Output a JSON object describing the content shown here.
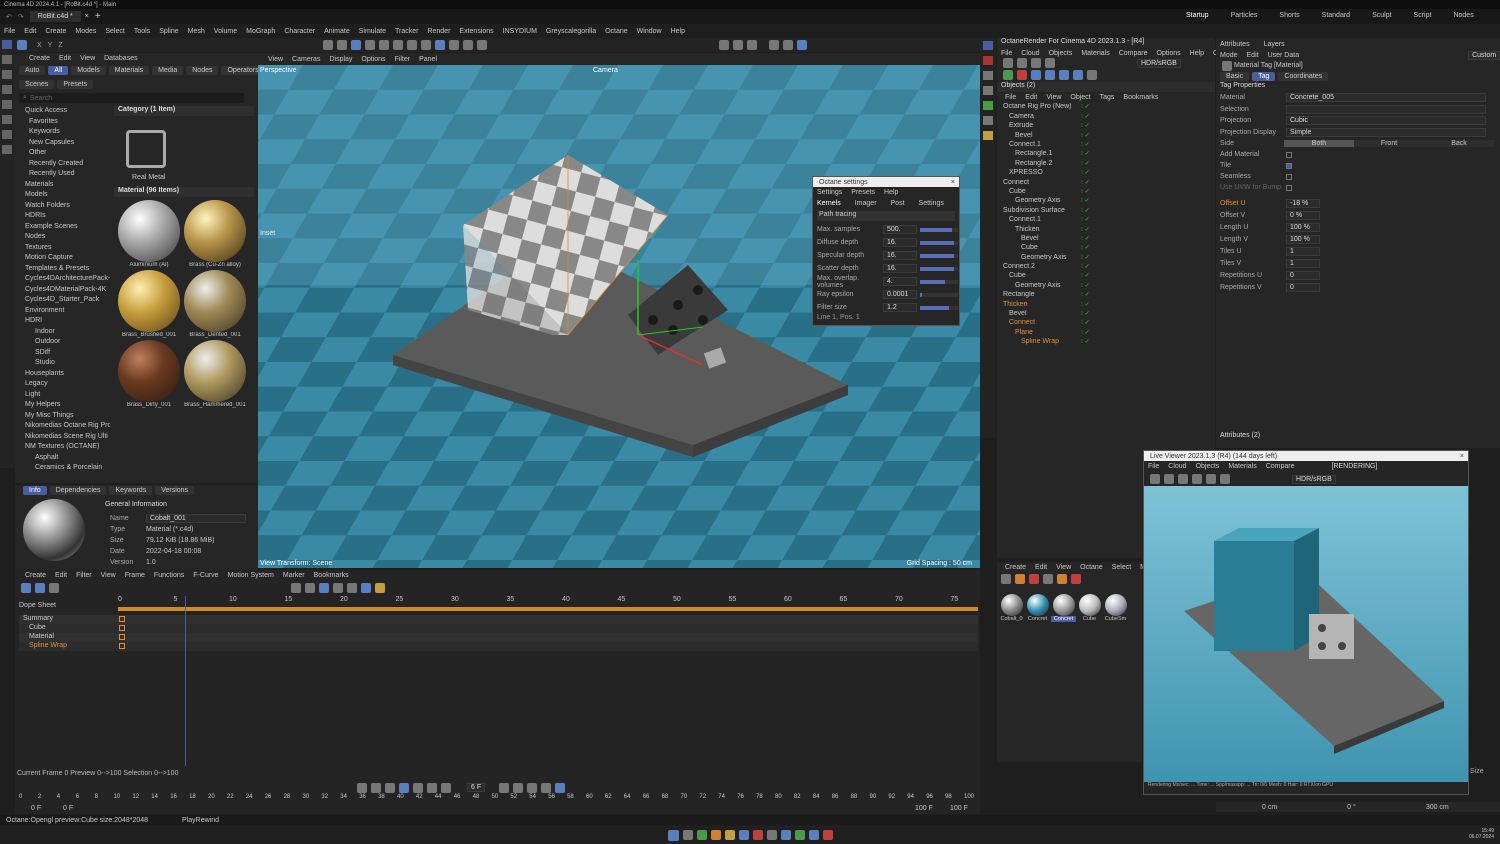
{
  "title_bar": {
    "text": "Cinema 4D 2024.4.1 - [RoBit.c4d *] - Main"
  },
  "doc_tab": {
    "label": "RoBit.c4d *"
  },
  "top_menu": [
    "File",
    "Edit",
    "Create",
    "Modes",
    "Select",
    "Tools",
    "Spline",
    "Mesh",
    "Volume",
    "MoGraph",
    "Character",
    "Animate",
    "Simulate",
    "Tracker",
    "Render",
    "Extensions",
    "INSYDIUM",
    "Greyscalegorilla",
    "Octane",
    "Window",
    "Help"
  ],
  "layouts": [
    "Startup",
    "Particles",
    "Shorts",
    "Standard",
    "Sculpt",
    "Script",
    "Nodes"
  ],
  "active_layout": "Startup",
  "asset_browser": {
    "menu": [
      "Create",
      "Edit",
      "View",
      "Databases"
    ],
    "tabs": [
      "Auto",
      "All",
      "Models",
      "Materials",
      "Media",
      "Nodes",
      "Operators"
    ],
    "tabs2": [
      "Scenes",
      "Presets"
    ],
    "search_placeholder": "Search",
    "tree": [
      "Quick Access",
      "Favorites",
      "Keywords",
      "New Capsules",
      "Other",
      "Recently Created",
      "Recently Used",
      "Materials",
      "Models",
      "Watch Folders",
      "HDRIs",
      "Example Scenes",
      "Nodes",
      "Textures",
      "Motion Capture",
      "Templates & Presets",
      "Cycles4DArchitecturePack-",
      "Cycles4DMaterialPack-4K",
      "Cycles4D_Starter_Pack",
      "Environment",
      "HDRI",
      "Indoor",
      "Outdoor",
      "SDiff",
      "Studio",
      "Houseplants",
      "Legacy",
      "Light",
      "My Helpers",
      "My Misc Things",
      "Nikomedias Octane Rig Pro",
      "Nikomedias Scene Rig Ulti",
      "NM Textures (OCTANE)",
      "Asphalt",
      "Ceramics & Porcelain"
    ],
    "category_header": "Category (1 Item)",
    "category_item": "Real Metal",
    "material_header": "Material (96 Items)",
    "materials": [
      "Aluminium (Al)",
      "Brass (Cu-Zn alloy)",
      "Brass_Brushed_001",
      "Brass_Dented_001",
      "Brass_Dirty_001",
      "Brass_Hammered_001"
    ],
    "info_tabs": [
      "Info",
      "Dependencies",
      "Keywords",
      "Versions"
    ],
    "info_section": "General Information",
    "info_fields": [
      {
        "k": "Name",
        "v": "Cobalt_001"
      },
      {
        "k": "Type",
        "v": "Material (*.c4d)"
      },
      {
        "k": "Size",
        "v": "79.12 KiB (18.86 MiB)"
      },
      {
        "k": "Date",
        "v": "2022-04-18 00:08"
      },
      {
        "k": "Version",
        "v": "1.0"
      }
    ]
  },
  "viewport": {
    "menu": [
      "View",
      "Cameras",
      "Display",
      "Options",
      "Filter",
      "Panel"
    ],
    "label": "Perspective",
    "camera": "Camera",
    "inset": "Inset",
    "bottom_left": "View Transform: Scene",
    "bottom_right": "Grid Spacing : 50 cm"
  },
  "octane_dialog": {
    "title": "Octane settings",
    "menu": [
      "Settings",
      "Presets",
      "Help"
    ],
    "tabs": [
      "Kernels",
      "Imager",
      "Post",
      "Settings"
    ],
    "kernel": "Path tracing",
    "params": [
      {
        "k": "Max. samples",
        "v": "500.",
        "f": 0.85
      },
      {
        "k": "Diffuse depth",
        "v": "16.",
        "f": 0.9
      },
      {
        "k": "Specular depth",
        "v": "16.",
        "f": 0.9
      },
      {
        "k": "Scatter depth",
        "v": "16.",
        "f": 0.9
      },
      {
        "k": "Max. overlap. volumes",
        "v": "4.",
        "f": 0.65
      },
      {
        "k": "Ray epsilon",
        "v": "0.0001",
        "f": 0.05
      },
      {
        "k": "Filter size",
        "v": "1.2",
        "f": 0.75
      }
    ],
    "status": "Line 1, Pos. 1"
  },
  "octane_panel": {
    "title": "OctaneRender For Cinema 4D 2023.1.3 - [R4]",
    "menu": [
      "File",
      "Cloud",
      "Objects",
      "Materials",
      "Compare",
      "Options",
      "Help",
      "GUI"
    ],
    "color": "HDR/sRGB"
  },
  "objects": {
    "header": "Objects (2)",
    "menu": [
      "File",
      "Edit",
      "View",
      "Object",
      "Tags",
      "Bookmarks"
    ],
    "items": [
      {
        "n": "Octane Rig Pro (New)",
        "d": 0
      },
      {
        "n": "Camera",
        "d": 1
      },
      {
        "n": "Extrude",
        "d": 1
      },
      {
        "n": "Bevel",
        "d": 2
      },
      {
        "n": "Connect.1",
        "d": 1
      },
      {
        "n": "Rectangle.1",
        "d": 2
      },
      {
        "n": "Rectangle.2",
        "d": 2
      },
      {
        "n": "XPRESSO",
        "d": 1
      },
      {
        "n": "Connect",
        "d": 0
      },
      {
        "n": "Cube",
        "d": 1
      },
      {
        "n": "Geometry Axis",
        "d": 2
      },
      {
        "n": "Subdivision Surface",
        "d": 0
      },
      {
        "n": "Connect.1",
        "d": 1
      },
      {
        "n": "Thicken",
        "d": 2
      },
      {
        "n": "Bevel",
        "d": 3
      },
      {
        "n": "Cube",
        "d": 3
      },
      {
        "n": "Geometry Axis",
        "d": 3
      },
      {
        "n": "Connect.2",
        "d": 0
      },
      {
        "n": "Cube",
        "d": 1
      },
      {
        "n": "Geometry Axis",
        "d": 2
      },
      {
        "n": "Rectangle",
        "d": 0
      },
      {
        "n": "Thicken",
        "d": 0,
        "o": 1
      },
      {
        "n": "Bevel",
        "d": 1
      },
      {
        "n": "Connect",
        "d": 1,
        "o": 1
      },
      {
        "n": "Plane",
        "d": 2,
        "o": 1
      },
      {
        "n": "Spline Wrap",
        "d": 3,
        "o": 1
      }
    ]
  },
  "attributes": {
    "tabs": [
      "Attributes",
      "Layers"
    ],
    "menu": [
      "Mode",
      "Edit",
      "User Data"
    ],
    "custom": "Custom",
    "title": "Material Tag [Material]",
    "sub_tabs": [
      "Basic",
      "Tag",
      "Coordinates"
    ],
    "section": "Tag Properties",
    "props": [
      {
        "k": "Material",
        "v": "Concrete_005"
      },
      {
        "k": "Selection",
        "v": ""
      },
      {
        "k": "Projection",
        "v": "Cubic"
      },
      {
        "k": "Projection Display",
        "v": "Simple"
      }
    ],
    "side_label": "Side",
    "side_opts": [
      "Both",
      "Front",
      "Back"
    ],
    "checks": [
      "Add Material",
      "Tile",
      "Seamless",
      "Use UVW for Bump"
    ],
    "nums": [
      {
        "k": "Offset U",
        "v": "-18 %",
        "o": 1
      },
      {
        "k": "Offset V",
        "v": "0 %"
      },
      {
        "k": "Length U",
        "v": "100 %"
      },
      {
        "k": "Length V",
        "v": "100 %"
      },
      {
        "k": "Tiles U",
        "v": "1"
      },
      {
        "k": "Tiles V",
        "v": "1"
      },
      {
        "k": "Repetitions U",
        "v": "0"
      },
      {
        "k": "Repetitions V",
        "v": "0"
      }
    ],
    "header2": "Attributes (2)"
  },
  "material_manager": {
    "menu": [
      "Create",
      "Edit",
      "View",
      "Octane",
      "Select",
      "Material"
    ],
    "mats": [
      "Cobalt_0",
      "Concret",
      "Concret",
      "Cube",
      "CubeSm"
    ]
  },
  "live_viewer": {
    "title": "Live Viewer 2023.1.3 (R4) (144 days left)",
    "menu": [
      "File",
      "Cloud",
      "Objects",
      "Materials",
      "Compare"
    ],
    "status": "[RENDERING]",
    "color": "HDR/sRGB",
    "footer": "Rendering    Ms/sec: ...    Time: ...    Spp/maxspp: ...    Tri: 0/0    Mesh: 0    Hair: 0    RTX/on    GPU"
  },
  "timeline": {
    "menu": [
      "Create",
      "Edit",
      "Filter",
      "View",
      "Frame",
      "Functions",
      "F-Curve",
      "Motion System",
      "Marker",
      "Bookmarks"
    ],
    "dope": "Dope Sheet",
    "tracks": [
      "Summary",
      "Cube",
      "Material",
      "Spline Wrap"
    ],
    "ruler": [
      "0",
      "5",
      "10",
      "15",
      "20",
      "25",
      "30",
      "35",
      "40",
      "45",
      "50",
      "55",
      "60",
      "65",
      "70",
      "75"
    ],
    "status": "Current Frame  0   Preview  0-->100     Selection  0-->100"
  },
  "transport": {
    "frame": "6 F",
    "start": "0 F",
    "start2": "0 F",
    "end": "100 F",
    "end2": "100 F",
    "ticks": [
      "0",
      "2",
      "4",
      "6",
      "8",
      "10",
      "12",
      "14",
      "16",
      "18",
      "20",
      "22",
      "24",
      "26",
      "28",
      "30",
      "32",
      "34",
      "36",
      "38",
      "40",
      "42",
      "44",
      "46",
      "48",
      "50",
      "52",
      "54",
      "56",
      "58",
      "60",
      "62",
      "64",
      "66",
      "68",
      "70",
      "72",
      "74",
      "76",
      "78",
      "80",
      "82",
      "84",
      "86",
      "88",
      "90",
      "92",
      "94",
      "96",
      "98",
      "100"
    ]
  },
  "coords": {
    "a": "0 cm",
    "b": "0 °",
    "c": "300 cm",
    "size": "Size"
  },
  "status_bar": {
    "left": "Octane:Opengl preview:Cube  size:2048*2048",
    "mid": "PlayRewind"
  },
  "taskbar": {
    "time": "15:49",
    "date": "06.07.2024"
  }
}
